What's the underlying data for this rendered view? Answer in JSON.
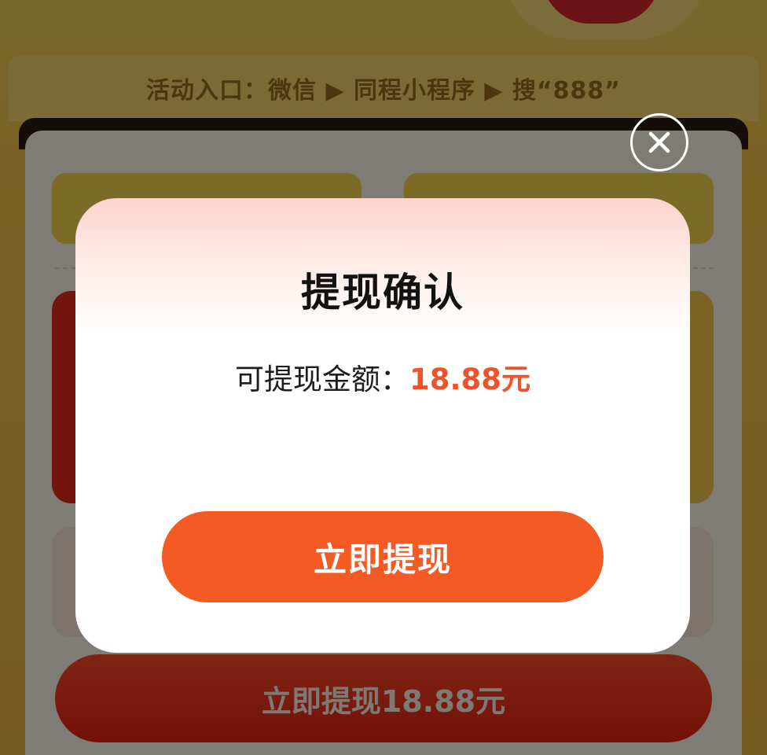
{
  "background": {
    "entry_text": "活动入口：微信 ▶ 同程小程序 ▶ 搜“888”",
    "withdraw_button_label": "立即提现18.88元"
  },
  "dialog": {
    "title": "提现确认",
    "amount_label": "可提现金额：",
    "amount_value": "18.88元",
    "confirm_button_label": "立即提现"
  },
  "icons": {
    "close": "close-icon"
  },
  "colors": {
    "accent_orange": "#f45a24",
    "amount_red": "#f0522a",
    "overlay": "rgba(0,0,0,0.5)"
  }
}
